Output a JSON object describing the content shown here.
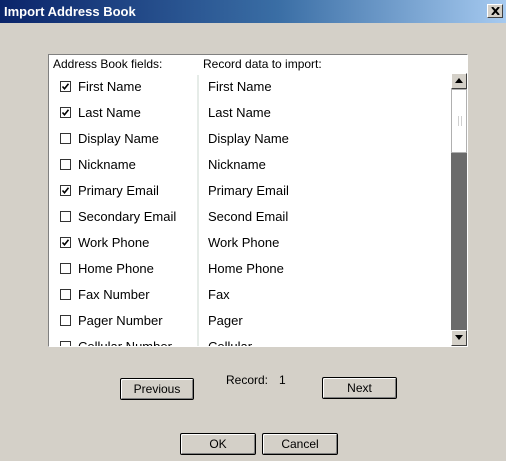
{
  "window": {
    "title": "Import Address Book",
    "close_icon": "close-icon"
  },
  "list": {
    "fields_header": "Address Book fields:",
    "record_header": "Record data to import:",
    "rows": [
      {
        "field": "First Name",
        "checked": true,
        "record": "First Name"
      },
      {
        "field": "Last Name",
        "checked": true,
        "record": "Last Name"
      },
      {
        "field": "Display Name",
        "checked": false,
        "record": "Display Name"
      },
      {
        "field": "Nickname",
        "checked": false,
        "record": "Nickname"
      },
      {
        "field": "Primary Email",
        "checked": true,
        "record": "Primary Email"
      },
      {
        "field": "Secondary Email",
        "checked": false,
        "record": "Second Email"
      },
      {
        "field": "Work Phone",
        "checked": true,
        "record": "Work Phone"
      },
      {
        "field": "Home Phone",
        "checked": false,
        "record": "Home Phone"
      },
      {
        "field": "Fax Number",
        "checked": false,
        "record": "Fax"
      },
      {
        "field": "Pager Number",
        "checked": false,
        "record": "Pager"
      },
      {
        "field": "Cellular Number",
        "checked": false,
        "record": "Cellular"
      }
    ]
  },
  "navigation": {
    "previous_label": "Previous",
    "record_label": "Record:",
    "record_number": "1",
    "next_label": "Next"
  },
  "actions": {
    "ok_label": "OK",
    "cancel_label": "Cancel"
  }
}
